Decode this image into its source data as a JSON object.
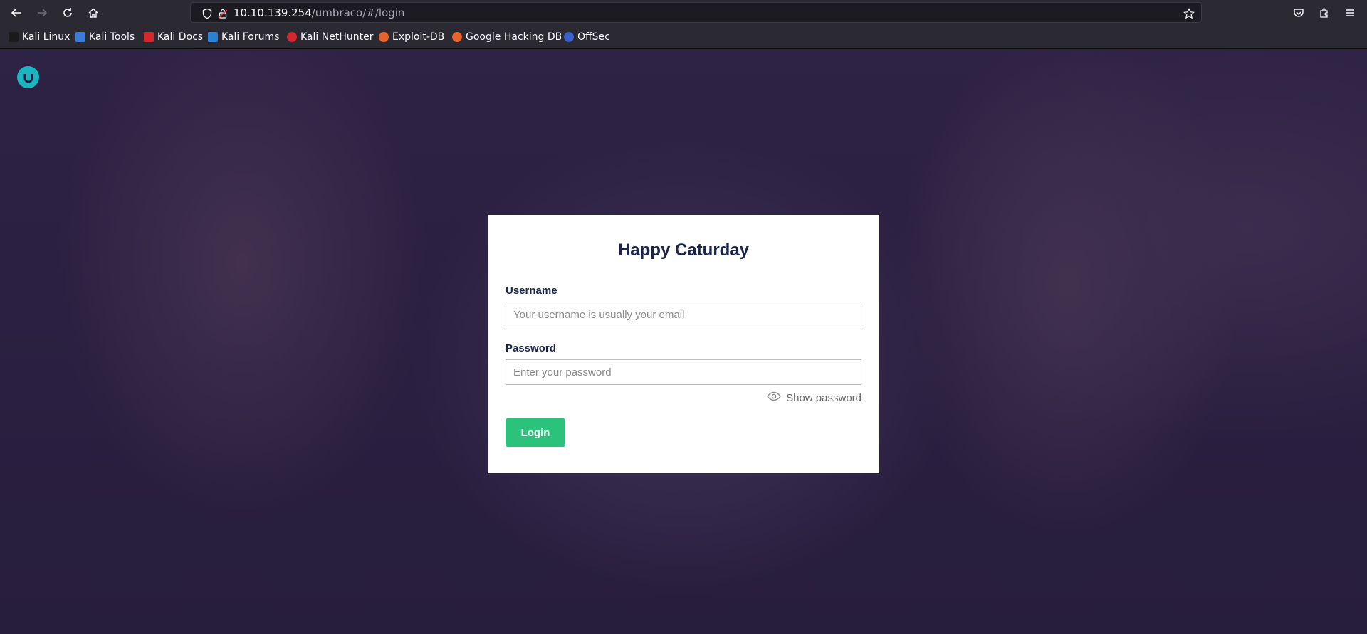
{
  "browser": {
    "url_host": "10.10.139.254",
    "url_path": "/umbraco/#/login",
    "icons": {
      "back": "back-arrow-icon",
      "forward": "forward-arrow-icon",
      "reload": "reload-icon",
      "home": "home-icon",
      "shield": "shield-icon",
      "lock": "lock-icon",
      "star": "bookmark-star-icon",
      "pocket": "pocket-icon",
      "extensions": "extensions-icon",
      "menu": "hamburger-menu-icon"
    },
    "bookmarks": [
      {
        "label": "Kali Linux",
        "color": "#2b2a33"
      },
      {
        "label": "Kali Tools",
        "color": "#3d7bd9"
      },
      {
        "label": "Kali Docs",
        "color": "#d6272f"
      },
      {
        "label": "Kali Forums",
        "color": "#2b7fd4"
      },
      {
        "label": "Kali NetHunter",
        "color": "#d6272f"
      },
      {
        "label": "Exploit-DB",
        "color": "#e8632b"
      },
      {
        "label": "Google Hacking DB",
        "color": "#e8632b"
      },
      {
        "label": "OffSec",
        "color": "#3a62c9"
      }
    ]
  },
  "page": {
    "logo": "umbraco-logo-icon",
    "accent": "#1bb5c0",
    "login": {
      "title": "Happy Caturday",
      "username_label": "Username",
      "username_placeholder": "Your username is usually your email",
      "password_label": "Password",
      "password_placeholder": "Enter your password",
      "show_password": "Show password",
      "login_button": "Login",
      "button_color": "#2bc37c"
    }
  }
}
